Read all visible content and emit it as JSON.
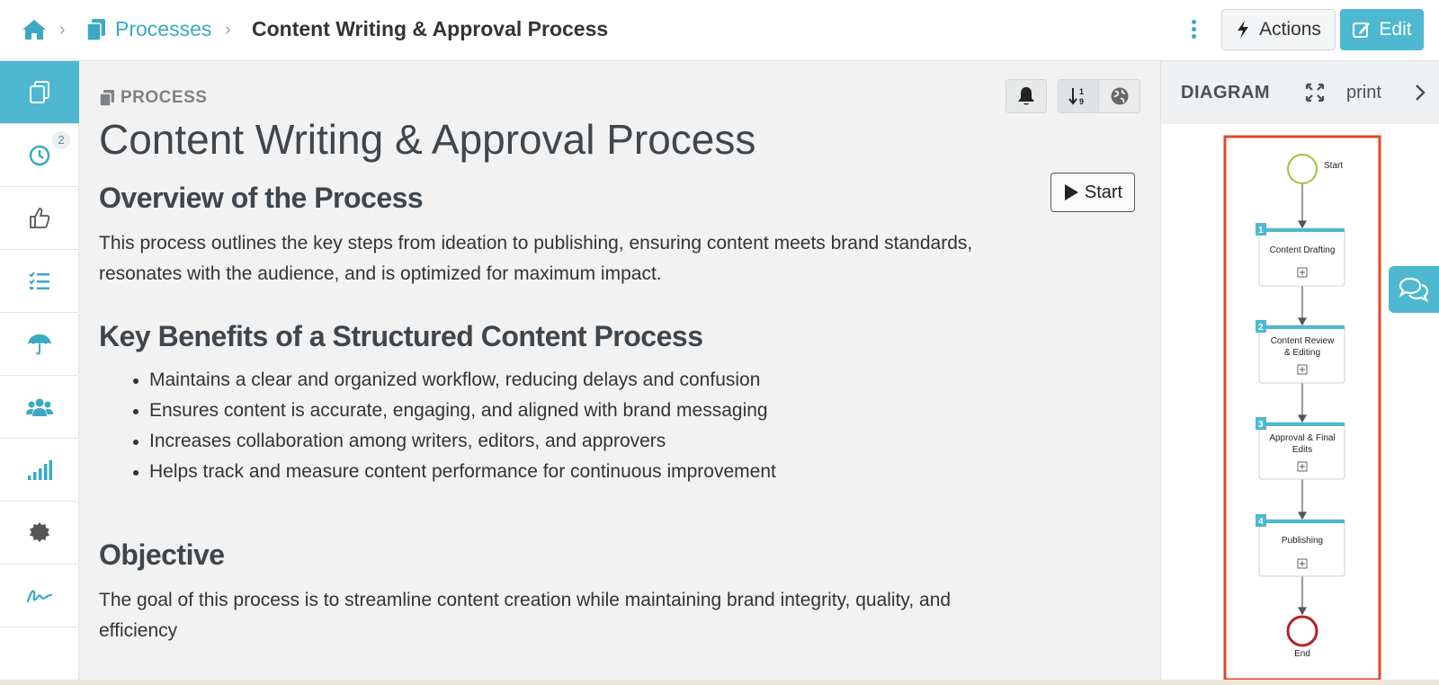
{
  "breadcrumb": {
    "home_icon": "home-icon",
    "separator": "›",
    "processes_label": "Processes",
    "current_label": "Content Writing & Approval Process"
  },
  "toolbar": {
    "actions_label": "Actions",
    "edit_label": "Edit"
  },
  "sidebar": {
    "items": [
      {
        "icon": "copy-icon",
        "active": true
      },
      {
        "icon": "clock-icon",
        "badge": "2"
      },
      {
        "icon": "thumbs-up-icon"
      },
      {
        "icon": "checklist-icon"
      },
      {
        "icon": "umbrella-icon"
      },
      {
        "icon": "users-icon"
      },
      {
        "icon": "signal-bars-icon"
      },
      {
        "icon": "gear-badge-icon"
      },
      {
        "icon": "signature-icon"
      }
    ]
  },
  "main": {
    "section_label": "PROCESS",
    "title": "Content Writing & Approval Process",
    "start_label": "Start",
    "overview_heading": "Overview of the Process",
    "overview_text": "This process outlines the key steps from ideation to publishing, ensuring content meets brand standards, resonates with the audience, and is optimized for maximum impact.",
    "benefits_heading": "Key Benefits of a Structured Content Process",
    "benefits": [
      "Maintains a clear and organized workflow, reducing delays and confusion",
      "Ensures content is accurate, engaging, and aligned with brand messaging",
      "Increases collaboration among writers, editors, and approvers",
      "Helps track and measure content performance for continuous improvement"
    ],
    "objective_heading": "Objective",
    "objective_text": "The goal of this process is to streamline content creation while maintaining brand integrity, quality, and efficiency"
  },
  "diagram_panel": {
    "title": "DIAGRAM",
    "print_label": "print",
    "start_label": "Start",
    "end_label": "End",
    "steps": [
      {
        "number": "1",
        "label_lines": [
          "Content Drafting"
        ]
      },
      {
        "number": "2",
        "label_lines": [
          "Content Review",
          "& Editing"
        ]
      },
      {
        "number": "3",
        "label_lines": [
          "Approval & Final",
          "Edits"
        ]
      },
      {
        "number": "4",
        "label_lines": [
          "Publishing"
        ]
      }
    ]
  },
  "colors": {
    "accent": "#4db8cf",
    "link": "#3ba9c2",
    "highlight_border": "#e0472a",
    "start_event": "#9cc43a",
    "end_event": "#b22222"
  }
}
